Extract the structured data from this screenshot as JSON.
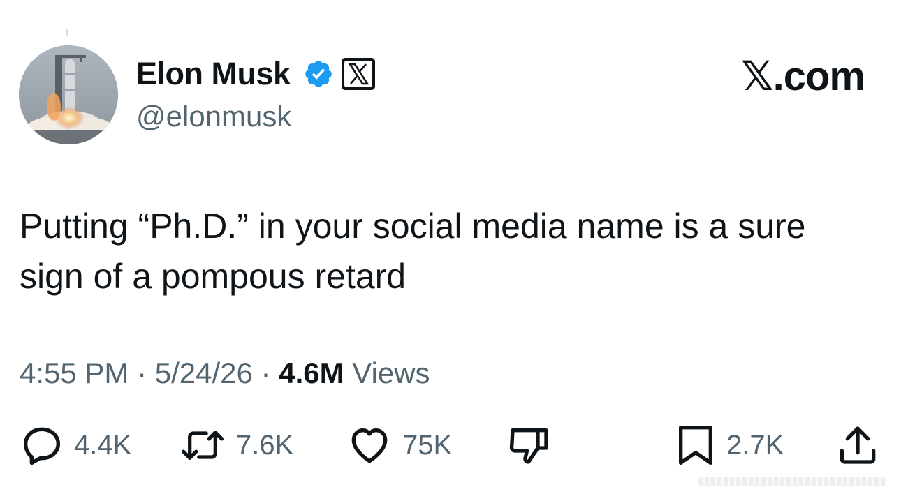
{
  "author": {
    "display_name": "Elon Musk",
    "handle": "@elonmusk",
    "verified_icon": "verified-badge-icon",
    "affiliate_icon": "x-logo-icon"
  },
  "brand": {
    "x_glyph": "𝕏",
    "suffix": ".com"
  },
  "tweet": {
    "text": "Putting “Ph.D.” in your social media name is a sure sign of a pompous retard"
  },
  "meta": {
    "time": "4:55 PM",
    "sep1": " · ",
    "date": "5/24/26",
    "sep2": " · ",
    "views_count": "4.6M",
    "views_label": " Views"
  },
  "actions": {
    "reply": {
      "icon": "reply-icon",
      "count": "4.4K"
    },
    "repost": {
      "icon": "repost-icon",
      "count": "7.6K"
    },
    "like": {
      "icon": "heart-icon",
      "count": "75K"
    },
    "dislike": {
      "icon": "thumbs-down-icon",
      "count": ""
    },
    "bookmark": {
      "icon": "bookmark-icon",
      "count": "2.7K"
    },
    "share": {
      "icon": "share-icon",
      "count": ""
    }
  },
  "colors": {
    "text": "#0f1419",
    "secondary": "#536471",
    "verified": "#1d9bf0"
  }
}
